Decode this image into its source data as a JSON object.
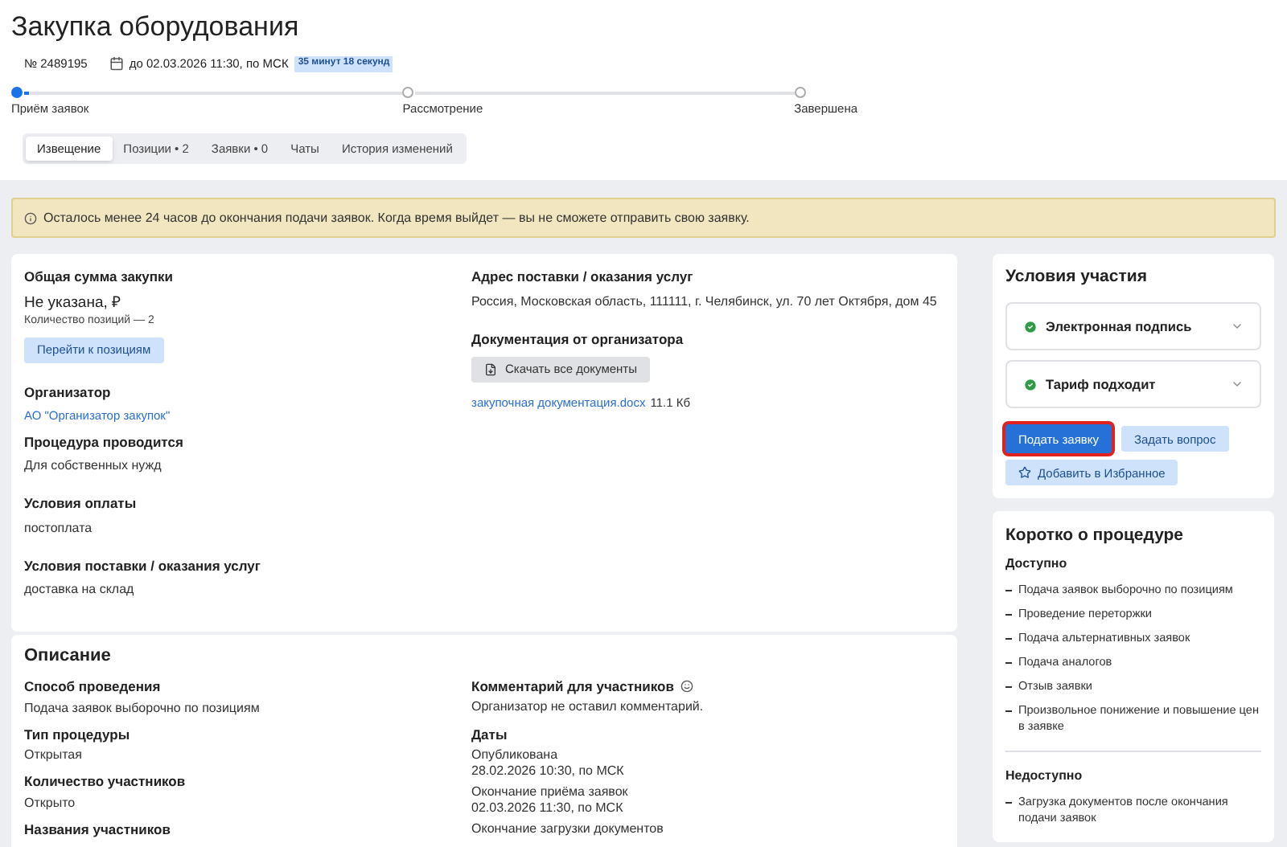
{
  "title": "Закупка оборудования",
  "meta": {
    "number": "№ 2489195",
    "deadline": "до 02.03.2026 11:30, по МСК",
    "countdown": "35 минут 18 секунд"
  },
  "stages": [
    {
      "label": "Приём заявок",
      "current": true
    },
    {
      "label": "Рассмотрение",
      "current": false
    },
    {
      "label": "Завершена",
      "current": false
    }
  ],
  "tabs": [
    {
      "label": "Извещение",
      "selected": true
    },
    {
      "label": "Позиции • 2",
      "selected": false
    },
    {
      "label": "Заявки • 0",
      "selected": false
    },
    {
      "label": "Чаты",
      "selected": false
    },
    {
      "label": "История изменений",
      "selected": false
    }
  ],
  "alert": "Осталось менее 24 часов до окончания подачи заявок. Когда время выйдет — вы не сможете отправить свою заявку.",
  "summary": {
    "total": {
      "label": "Общая сумма закупки",
      "value": "Не указана, ₽",
      "count": "Количество позиций — 2",
      "button": "Перейти к позициям"
    },
    "organizer": {
      "label": "Организатор",
      "link": "АО \"Организатор закупок\""
    },
    "fields": [
      {
        "label": "Процедура проводится",
        "value": "Для собственных нужд"
      },
      {
        "label": "Условия оплаты",
        "value": "постоплата"
      },
      {
        "label": "Условия поставки / оказания услуг",
        "value": "доставка на склад"
      }
    ],
    "address": {
      "label": "Адрес поставки / оказания услуг",
      "value": "Россия, Московская область, 111111, г. Челябинск, ул. 70 лет Октября, дом 45"
    },
    "docs": {
      "label": "Документация от организатора",
      "button": "Скачать все документы",
      "file": "закупочная документация.docx",
      "size": "11.1 Кб"
    }
  },
  "description": {
    "title": "Описание",
    "fields": [
      {
        "label": "Способ проведения",
        "value": "Подача заявок выборочно по позициям"
      },
      {
        "label": "Тип процедуры",
        "value": "Открытая"
      },
      {
        "label": "Количество участников",
        "value": "Открыто"
      },
      {
        "label": "Названия участников"
      }
    ],
    "comment": {
      "label": "Комментарий для участников",
      "value": "Организатор не оставил комментарий."
    },
    "dates": {
      "label": "Даты",
      "items": [
        {
          "label": "Опубликована",
          "value": "28.02.2026 10:30, по МСК"
        },
        {
          "label": "Окончание приёма заявок",
          "value": "02.03.2026 11:30, по МСК"
        },
        {
          "label": "Окончание загрузки документов"
        }
      ]
    }
  },
  "conditions": {
    "title": "Условия участия",
    "checks": [
      {
        "label": "Электронная подпись",
        "ok": true
      },
      {
        "label": "Тариф подходит",
        "ok": true
      }
    ],
    "submit": {
      "label": "Подать заявку",
      "focused": true
    },
    "ask": "Задать вопрос",
    "favorite": "Добавить в Избранное"
  },
  "brief": {
    "title": "Коротко о процедуре",
    "groups": [
      {
        "label": "Доступно",
        "items": [
          "Подача заявок выборочно по позициям",
          "Проведение переторжки",
          "Подача альтернативных заявок",
          "Подача аналогов",
          "Отзыв заявки",
          "Произвольное понижение и повышение цен в заявке"
        ]
      },
      {
        "label": "Недоступно",
        "items": [
          "Загрузка документов после окончания подачи заявок"
        ]
      }
    ]
  }
}
